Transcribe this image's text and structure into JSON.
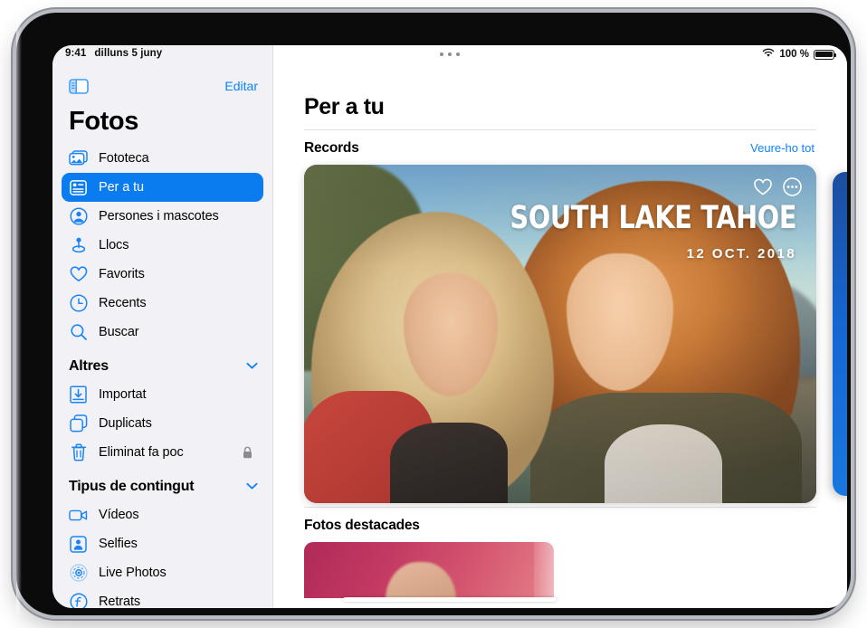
{
  "status_bar": {
    "time": "9:41",
    "date": "dilluns 5 juny",
    "battery_percent": "100 %",
    "wifi_icon": "wifi-icon",
    "battery_icon": "battery-icon",
    "multitask_icon": "multitask-dots-icon"
  },
  "sidebar": {
    "toggle_icon": "sidebar-toggle-icon",
    "edit_label": "Editar",
    "title": "Fotos",
    "primary_items": [
      {
        "label": "Fototeca",
        "icon": "photo-library-icon",
        "selected": false
      },
      {
        "label": "Per a tu",
        "icon": "for-you-card-icon",
        "selected": true
      },
      {
        "label": "Persones i mascotes",
        "icon": "person-circle-icon",
        "selected": false
      },
      {
        "label": "Llocs",
        "icon": "location-pin-icon",
        "selected": false
      },
      {
        "label": "Favorits",
        "icon": "heart-icon",
        "selected": false
      },
      {
        "label": "Recents",
        "icon": "clock-icon",
        "selected": false
      },
      {
        "label": "Buscar",
        "icon": "search-icon",
        "selected": false
      }
    ],
    "section_others": {
      "title": "Altres",
      "chevron_icon": "chevron-down-icon",
      "items": [
        {
          "label": "Importat",
          "icon": "import-tray-icon",
          "locked": false
        },
        {
          "label": "Duplicats",
          "icon": "duplicate-squares-icon",
          "locked": false
        },
        {
          "label": "Eliminat fa poc",
          "icon": "trash-icon",
          "locked": true,
          "lock_icon": "lock-icon"
        }
      ]
    },
    "section_content_types": {
      "title": "Tipus de contingut",
      "chevron_icon": "chevron-down-icon",
      "items": [
        {
          "label": "Vídeos",
          "icon": "video-camera-icon"
        },
        {
          "label": "Selfies",
          "icon": "selfie-person-icon"
        },
        {
          "label": "Live Photos",
          "icon": "live-photos-icon"
        },
        {
          "label": "Retrats",
          "icon": "portrait-f-icon"
        }
      ]
    }
  },
  "main": {
    "page_title": "Per a tu",
    "memories_section": {
      "title": "Records",
      "see_all_label": "Veure-ho tot",
      "card": {
        "title": "SOUTH LAKE TAHOE",
        "date": "12 OCT. 2018",
        "favorite_icon": "heart-icon",
        "more_icon": "ellipsis-circle-icon"
      }
    },
    "featured_section": {
      "title": "Fotos destacades"
    }
  },
  "colors": {
    "accent_blue": "#0a84ff",
    "selected_blue": "#0a7cf0",
    "sidebar_bg": "#f2f2f6",
    "divider": "#e0e0e3",
    "next_card_blue": "#1565cf"
  }
}
